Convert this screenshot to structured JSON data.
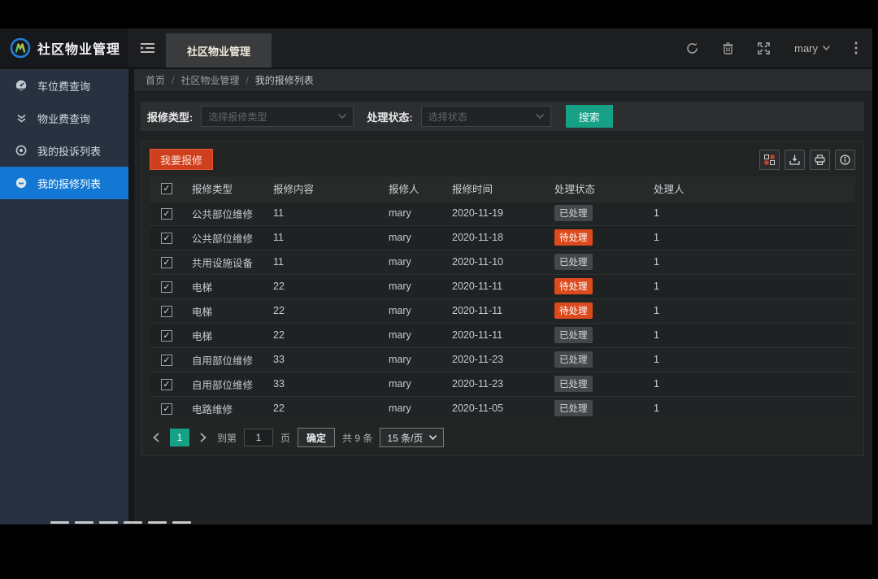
{
  "app": {
    "title": "社区物业管理",
    "active_tab": "社区物业管理",
    "user": "mary"
  },
  "breadcrumb": {
    "separator": "/",
    "items": [
      "首页",
      "社区物业管理",
      "我的报修列表"
    ]
  },
  "sidebar": {
    "items": [
      {
        "label": "车位费查询",
        "icon": "gauge-icon",
        "active": false
      },
      {
        "label": "物业费查询",
        "icon": "double-chevron-down-icon",
        "active": false
      },
      {
        "label": "我的投诉列表",
        "icon": "target-icon",
        "active": false
      },
      {
        "label": "我的报修列表",
        "icon": "circle-dash-icon",
        "active": true
      }
    ]
  },
  "filters": {
    "type_label": "报修类型:",
    "type_placeholder": "选择报修类型",
    "status_label": "处理状态:",
    "status_placeholder": "选择状态",
    "search_label": "搜索"
  },
  "toolbar": {
    "report_label": "我要报修",
    "icons": [
      "columns-grid-icon",
      "export-icon",
      "printer-icon",
      "info-icon"
    ]
  },
  "header_icons": [
    "refresh-icon",
    "trash-icon",
    "fullscreen-icon",
    "kebab-menu-icon"
  ],
  "table": {
    "headers": [
      "报修类型",
      "报修内容",
      "报修人",
      "报修时间",
      "处理状态",
      "处理人"
    ],
    "rows": [
      {
        "type": "公共部位维修",
        "content": "11",
        "reporter": "mary",
        "time": "2020-11-19",
        "status": "已处理",
        "status_kind": "done",
        "handler": "1",
        "checked": true
      },
      {
        "type": "公共部位维修",
        "content": "11",
        "reporter": "mary",
        "time": "2020-11-18",
        "status": "待处理",
        "status_kind": "pending",
        "handler": "1",
        "checked": true
      },
      {
        "type": "共用设施设备",
        "content": "11",
        "reporter": "mary",
        "time": "2020-11-10",
        "status": "已处理",
        "status_kind": "done",
        "handler": "1",
        "checked": true
      },
      {
        "type": "电梯",
        "content": "22",
        "reporter": "mary",
        "time": "2020-11-11",
        "status": "待处理",
        "status_kind": "pending",
        "handler": "1",
        "checked": true
      },
      {
        "type": "电梯",
        "content": "22",
        "reporter": "mary",
        "time": "2020-11-11",
        "status": "待处理",
        "status_kind": "pending",
        "handler": "1",
        "checked": true
      },
      {
        "type": "电梯",
        "content": "22",
        "reporter": "mary",
        "time": "2020-11-11",
        "status": "已处理",
        "status_kind": "done",
        "handler": "1",
        "checked": true
      },
      {
        "type": "自用部位维修",
        "content": "33",
        "reporter": "mary",
        "time": "2020-11-23",
        "status": "已处理",
        "status_kind": "done",
        "handler": "1",
        "checked": true
      },
      {
        "type": "自用部位维修",
        "content": "33",
        "reporter": "mary",
        "time": "2020-11-23",
        "status": "已处理",
        "status_kind": "done",
        "handler": "1",
        "checked": true
      },
      {
        "type": "电路维修",
        "content": "22",
        "reporter": "mary",
        "time": "2020-11-05",
        "status": "已处理",
        "status_kind": "done",
        "handler": "1",
        "checked": true
      }
    ],
    "header_checkbox_checked": true,
    "check_glyph": "✓"
  },
  "pagination": {
    "current_page": "1",
    "goto_label": "到第",
    "goto_value": "1",
    "page_unit_label": "页",
    "confirm_label": "确定",
    "total_label": "共 9 条",
    "page_size_label": "15 条/页"
  },
  "colors": {
    "accent_blue": "#1278d3",
    "teal_green": "#16a085",
    "danger_red": "#cd3f1d",
    "pending_orange": "#dd4a1d",
    "done_badge_bg": "#43484b"
  }
}
